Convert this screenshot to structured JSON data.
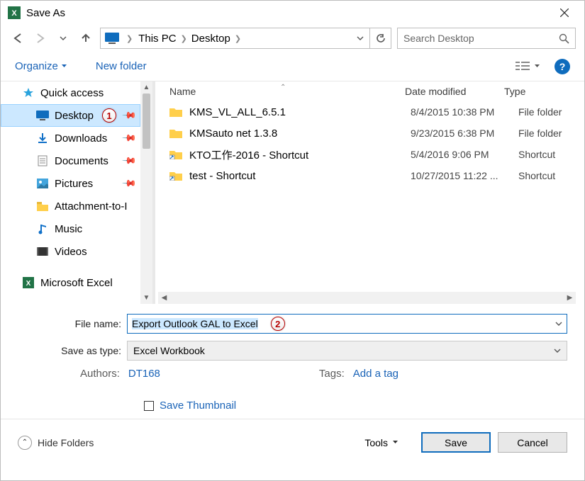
{
  "title": "Save As",
  "breadcrumbs": [
    "This PC",
    "Desktop"
  ],
  "search_placeholder": "Search Desktop",
  "toolbar": {
    "organize": "Organize",
    "newfolder": "New folder"
  },
  "sidebar": {
    "header": "Quick access",
    "items": [
      {
        "label": "Desktop",
        "selected": true,
        "pinned": true,
        "badge": "1"
      },
      {
        "label": "Downloads",
        "pinned": true
      },
      {
        "label": "Documents",
        "pinned": true
      },
      {
        "label": "Pictures",
        "pinned": true
      },
      {
        "label": "Attachment-to-I"
      },
      {
        "label": "Music"
      },
      {
        "label": "Videos"
      }
    ],
    "footer": "Microsoft Excel"
  },
  "columns": {
    "name": "Name",
    "date": "Date modified",
    "type": "Type"
  },
  "files": [
    {
      "name": "KMS_VL_ALL_6.5.1",
      "date": "8/4/2015 10:38 PM",
      "type": "File folder",
      "kind": "folder"
    },
    {
      "name": "KMSauto net 1.3.8",
      "date": "9/23/2015 6:38 PM",
      "type": "File folder",
      "kind": "folder"
    },
    {
      "name": "KTO工作-2016 - Shortcut",
      "date": "5/4/2016 9:06 PM",
      "type": "Shortcut",
      "kind": "shortcut"
    },
    {
      "name": "test - Shortcut",
      "date": "10/27/2015 11:22 ...",
      "type": "Shortcut",
      "kind": "shortcut"
    }
  ],
  "form": {
    "file_name_label": "File name:",
    "file_name_value": "Export Outlook GAL to Excel",
    "file_name_badge": "2",
    "save_type_label": "Save as type:",
    "save_type_value": "Excel Workbook",
    "authors_label": "Authors:",
    "authors_value": "DT168",
    "tags_label": "Tags:",
    "tags_value": "Add a tag",
    "thumb_label": "Save Thumbnail"
  },
  "footer": {
    "hide": "Hide Folders",
    "tools": "Tools",
    "save": "Save",
    "cancel": "Cancel"
  }
}
